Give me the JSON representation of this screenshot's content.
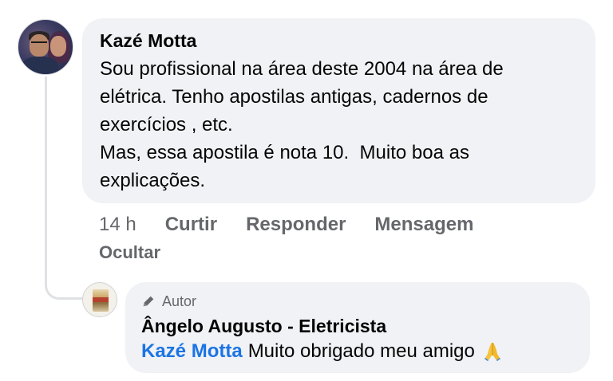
{
  "comment": {
    "author": "Kazé Motta",
    "text": "Sou profissional na área deste 2004 na área de\nelétrica. Tenho apostilas antigas, cadernos de\nexercícios , etc.\nMas, essa apostila é nota 10.  Muito boa as\nexplicações.",
    "time": "14 h",
    "actions": {
      "like": "Curtir",
      "reply": "Responder",
      "message": "Mensagem",
      "hide": "Ocultar"
    }
  },
  "reply": {
    "role_badge": "Autor",
    "role_icon": "pencil-icon",
    "author": "Ângelo Augusto - Eletricista",
    "mention": "Kazé Motta",
    "text": "Muito obrigado meu amigo",
    "emoji_icon": "folded-hands-icon"
  },
  "colors": {
    "bubble_bg": "#f0f2f5",
    "mention": "#1b74e4",
    "secondary_text": "#65676b",
    "primary_text": "#050505"
  }
}
